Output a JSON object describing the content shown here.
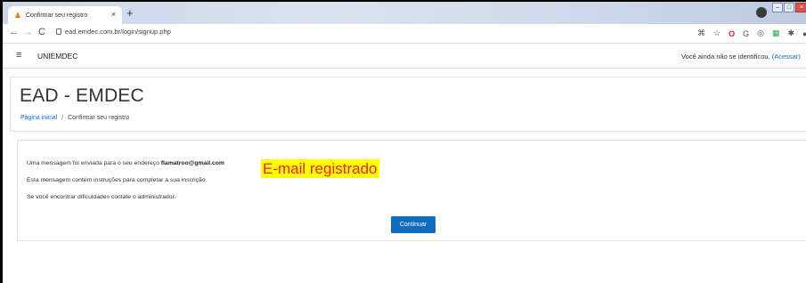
{
  "browser": {
    "tab_title": "Confirmar seu registro",
    "tab_close": "×",
    "new_tab": "+",
    "url": "ead.emdec.com.br/login/signup.php",
    "nav": {
      "back": "←",
      "forward": "→",
      "reload": "C"
    },
    "extensions": [
      "⌘",
      "☆",
      "O",
      "G",
      "◎",
      "▦",
      "✱",
      "●"
    ]
  },
  "navbar": {
    "brand": "UNIEMDEC",
    "user_text": "Você ainda não se identificou.",
    "login_link": "(Acessar)"
  },
  "header": {
    "title": "EAD - EMDEC",
    "breadcrumb": {
      "home": "Página inicial",
      "separator": "/",
      "current": "Confirmar seu registro"
    }
  },
  "content": {
    "line1_prefix": "Uma mensagem foi enviada para o seu endereço ",
    "email": "flamatroo@gmail.com",
    "line2": "Esta mensagem contém instruções para completar a sua inscrição.",
    "line3": "Se você encontrar dificuldades contate o administrador.",
    "annotation": "E-mail registrado",
    "continue_label": "Continuar"
  },
  "colors": {
    "link": "#0f6cbf",
    "button": "#0f6cbf",
    "annotation_bg": "#ffff00",
    "annotation_text": "#e8232a"
  }
}
